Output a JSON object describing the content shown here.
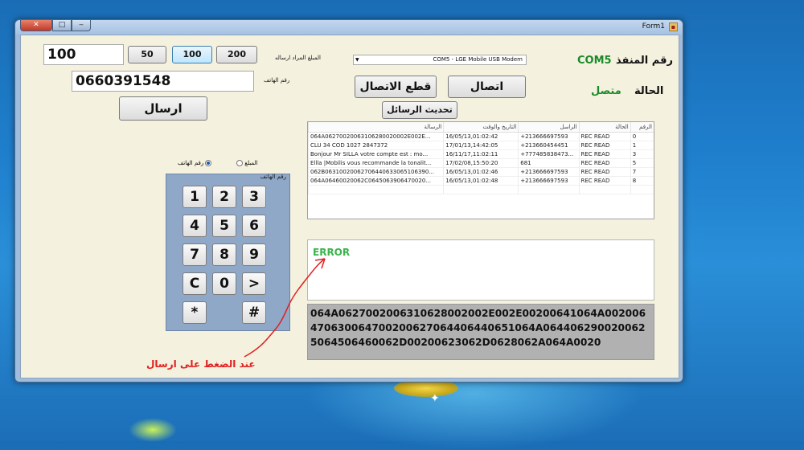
{
  "window": {
    "title": "Form1"
  },
  "top": {
    "amount_value": "100",
    "amount_buttons": [
      "50",
      "100",
      "200"
    ],
    "amount_label": "المبلغ المراد ارساله",
    "phone_label": "رقم الهاتف",
    "phone_value": "0660391548",
    "send_label": "ارسال"
  },
  "port": {
    "combo_value": "COM5 - LGE Mobile USB Modem",
    "port_label": "رقم المنفذ",
    "port_value": "COM5",
    "state_label": "الحالة",
    "state_value": "متصل",
    "disconnect_label": "قطع الاتصال",
    "connect_label": "اتصال",
    "refresh_label": "تحديث الرسائل"
  },
  "mode": {
    "amount_option": "المبلغ",
    "phone_option": "رقم الهاتف",
    "selected": "phone",
    "keypad_title": "رقم الهاتف"
  },
  "keypad": {
    "keys": [
      "1",
      "2",
      "3",
      "4",
      "5",
      "6",
      "7",
      "8",
      "9",
      "C",
      "0",
      ">",
      "*",
      "#"
    ]
  },
  "messages": {
    "columns": [
      "الرسالة",
      "التاريخ والوقت",
      "الراسل",
      "الحالة",
      "الرقم"
    ],
    "rows": [
      {
        "message": "064A06270020063106280020002E002E...",
        "date": "16/05/13,01:02:42",
        "sender": "+213666697593",
        "status": "REC READ",
        "num": "0"
      },
      {
        "message": "CLU 34        COD 1027  2847372",
        "date": "17/01/13,14:42:05",
        "sender": "+213660454451",
        "status": "REC READ",
        "num": "1"
      },
      {
        "message": "Bonjour Mr SILLA votre compte est : mo...",
        "date": "16/11/17,11:02:11",
        "sender": "+777485838473...",
        "status": "REC READ",
        "num": "3"
      },
      {
        "message": "Ellla  |Mobilis vous recommande la tonalit...",
        "date": "17/02/08,15:50:20",
        "sender": "681",
        "status": "REC READ",
        "num": "5"
      },
      {
        "message": "062B06310020062706440633065106390...",
        "date": "16/05/13,01:02:46",
        "sender": "+213666697593",
        "status": "REC READ",
        "num": "7"
      },
      {
        "message": "064A06460020062C0645063906470020...",
        "date": "16/05/13,01:02:48",
        "sender": "+213666697593",
        "status": "REC READ",
        "num": "8"
      }
    ]
  },
  "output": {
    "error_text": "ERROR",
    "hex_text": "064A0627002006310628002002E002E00200641064A002006470630064700200627064406440651064A0644062900200625064506460062D00200623062D0628062A064A0020"
  },
  "annotation": {
    "text": "عند الضغط على ارسال",
    "color": "#e02020"
  }
}
